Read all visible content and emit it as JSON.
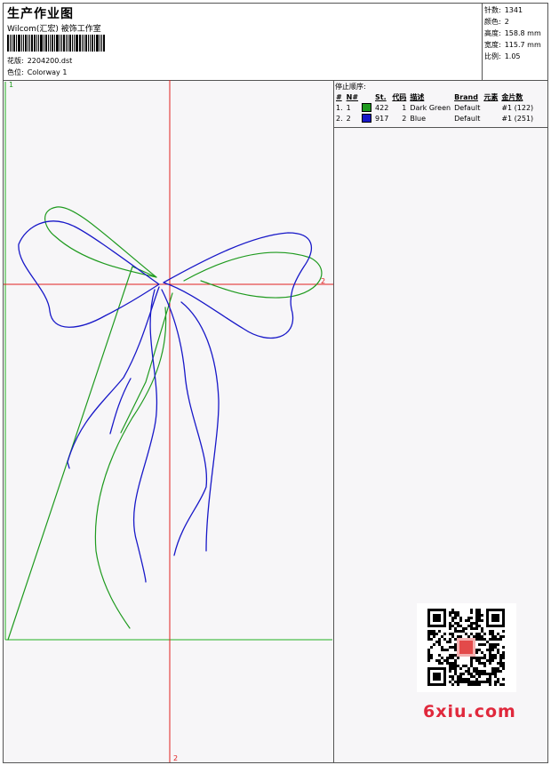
{
  "header": {
    "title": "生产作业图",
    "studio": "Wilcom(汇宏) 被饰工作室",
    "design_label": "花版:",
    "design_value": "2204200.dst",
    "colorway_label": "色位:",
    "colorway_value": "Colorway 1"
  },
  "stats": [
    {
      "label": "针数:",
      "value": "1341"
    },
    {
      "label": "颜色:",
      "value": "2"
    },
    {
      "label": "高度:",
      "value": "158.8 mm"
    },
    {
      "label": "宽度:",
      "value": "115.7 mm"
    },
    {
      "label": "比例:",
      "value": "1.05"
    }
  ],
  "canvas": {
    "markers": {
      "start": "1",
      "right": "2",
      "bottom": "2"
    },
    "colors": {
      "green": "#1e9a1e",
      "blue": "#1818c8",
      "crosshair": "#e02020",
      "frame": "#20b020"
    }
  },
  "stop_list": {
    "heading": "停止顺序:",
    "columns": [
      "#",
      "N#",
      "St.",
      "代码",
      "描述",
      "Brand",
      "元素",
      "金片数"
    ],
    "rows": [
      {
        "n": "1.",
        "needle": "1",
        "color": "#1e9a1e",
        "stitches": "422",
        "code": "1",
        "desc": "Dark Green",
        "brand": "Default",
        "seq": "#1 (122)"
      },
      {
        "n": "2.",
        "needle": "2",
        "color": "#1818c8",
        "stitches": "917",
        "code": "2",
        "desc": "Blue",
        "brand": "Default",
        "seq": "#1 (251)"
      }
    ]
  },
  "watermark": {
    "logo_text": "6xiu.com"
  }
}
